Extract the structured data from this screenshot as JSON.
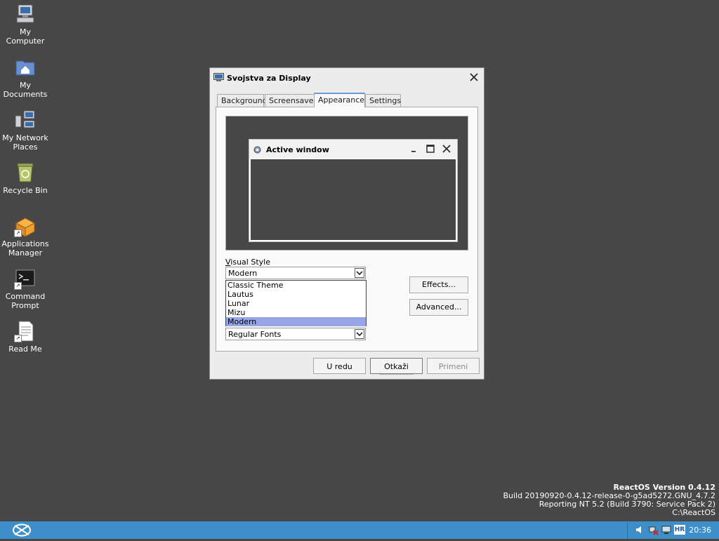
{
  "desktop": {
    "icons": [
      {
        "label": "My\nComputer",
        "icon": "computer-icon"
      },
      {
        "label": "My\nDocuments",
        "icon": "documents-folder-icon"
      },
      {
        "label": "My Network\nPlaces",
        "icon": "network-places-icon"
      },
      {
        "label": "Recycle Bin",
        "icon": "recycle-bin-icon"
      },
      {
        "label": "Applications\nManager",
        "icon": "applications-manager-icon"
      },
      {
        "label": "Command\nPrompt",
        "icon": "command-prompt-icon"
      },
      {
        "label": "Read Me",
        "icon": "readme-document-icon"
      }
    ]
  },
  "dialog": {
    "title": "Svojstva za Display",
    "tabs": [
      {
        "label": "Background"
      },
      {
        "label": "Screensaver"
      },
      {
        "label": "Appearance"
      },
      {
        "label": "Settings"
      }
    ],
    "active_tab": "Appearance",
    "preview": {
      "window_title": "Active window"
    },
    "visual_style": {
      "label": "Visual Style",
      "selected": "Modern",
      "options": [
        "Classic Theme",
        "Lautus",
        "Lunar",
        "Mizu",
        "Modern"
      ]
    },
    "font_size_combo": {
      "selected": "Regular Fonts"
    },
    "effects_button": "Effects...",
    "advanced_button": "Advanced...",
    "ok_button": "U redu",
    "cancel_button": "Otkaži",
    "apply_button": "Primeni"
  },
  "watermark": {
    "line1": "ReactOS Version 0.4.12",
    "line2": "Build 20190920-0.4.12-release-0-g5ad5272.GNU_4.7.2",
    "line3": "Reporting NT 5.2 (Build 3790: Service Pack 2)",
    "line4": "C:\\ReactOS"
  },
  "taskbar": {
    "tray": {
      "language": "HR",
      "clock": "20:36"
    }
  },
  "colors": {
    "desktop": "#474747",
    "taskbar": "#3d8fc9",
    "selection": "#95a5e6"
  }
}
